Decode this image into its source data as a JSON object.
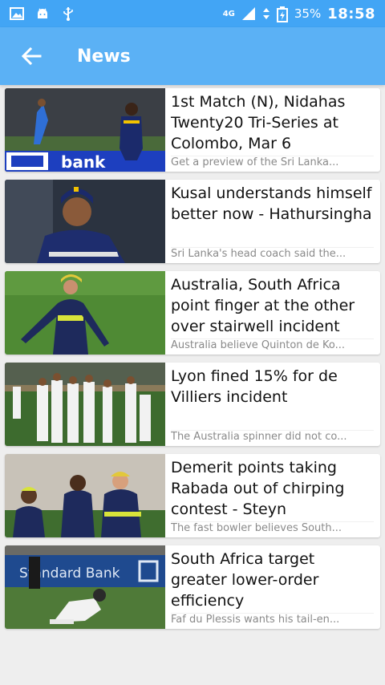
{
  "status_bar": {
    "network": "4G",
    "battery_percent": "35%",
    "time": "18:58",
    "icons": [
      "image-icon",
      "android-icon",
      "usb-icon",
      "signal-icon",
      "data-arrows-icon",
      "battery-icon"
    ]
  },
  "app_bar": {
    "title": "News",
    "back_icon": "arrow-left-icon"
  },
  "news": [
    {
      "headline": "1st Match (N), Nidahas Twenty20 Tri-Series at Colombo, Mar 6",
      "summary": "Get a preview of the Sri Lanka..."
    },
    {
      "headline": "Kusal understands himself better now - Hathursingha",
      "summary": "Sri Lanka's head coach said the..."
    },
    {
      "headline": "Australia, South Africa point finger at the other over stairwell incident",
      "summary": "Australia believe Quinton de Ko..."
    },
    {
      "headline": "Lyon fined 15% for de Villiers incident",
      "summary": "The Australia spinner did not co..."
    },
    {
      "headline": "Demerit points taking Rabada out of chirping contest - Steyn",
      "summary": "The fast bowler believes South..."
    },
    {
      "headline": "South Africa target greater lower-order efficiency",
      "summary": "Faf du Plessis wants his tail-en..."
    }
  ],
  "thumb_text": {
    "t1_board": "bank",
    "t6_board": "Standard Bank"
  }
}
